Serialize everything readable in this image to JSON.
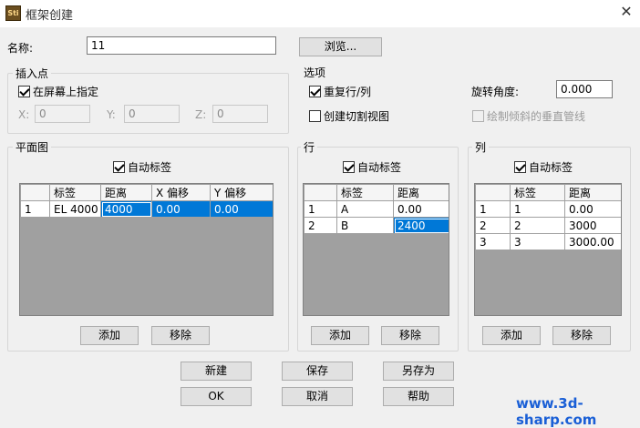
{
  "window": {
    "title": "框架创建",
    "icon_text": "Sti"
  },
  "name_row": {
    "label": "名称:",
    "value": "11",
    "browse_label": "浏览..."
  },
  "insert_point": {
    "title": "插入点",
    "on_screen_label": "在屏幕上指定",
    "on_screen_checked": true,
    "x_label": "X:",
    "x_value": "0",
    "y_label": "Y:",
    "y_value": "0",
    "z_label": "Z:",
    "z_value": "0"
  },
  "options": {
    "title": "选项",
    "repeat_label": "重复行/列",
    "repeat_checked": true,
    "cut_view_label": "创建切割视图",
    "cut_view_checked": false,
    "rotation_label": "旋转角度:",
    "rotation_value": "0.000",
    "draw_vertical_label": "绘制倾斜的垂直管线",
    "draw_vertical_checked": false
  },
  "plan": {
    "title": "平面图",
    "auto_label": "自动标签",
    "auto_checked": true,
    "headers": [
      "",
      "标签",
      "距离",
      "X 偏移",
      "Y 偏移"
    ],
    "rows": [
      [
        "1",
        "EL 4000",
        "4000",
        "0.00",
        "0.00"
      ]
    ],
    "add_label": "添加",
    "remove_label": "移除"
  },
  "rows_panel": {
    "title": "行",
    "auto_label": "自动标签",
    "auto_checked": true,
    "headers": [
      "",
      "标签",
      "距离"
    ],
    "rows": [
      [
        "1",
        "A",
        "0.00"
      ],
      [
        "2",
        "B",
        "2400"
      ]
    ],
    "add_label": "添加",
    "remove_label": "移除"
  },
  "cols_panel": {
    "title": "列",
    "auto_label": "自动标签",
    "auto_checked": true,
    "headers": [
      "",
      "标签",
      "距离"
    ],
    "rows": [
      [
        "1",
        "1",
        "0.00"
      ],
      [
        "2",
        "2",
        "3000"
      ],
      [
        "3",
        "3",
        "3000.00"
      ]
    ],
    "add_label": "添加",
    "remove_label": "移除"
  },
  "bottom_buttons": {
    "new": "新建",
    "save": "保存",
    "save_as": "另存为",
    "ok": "OK",
    "cancel": "取消",
    "help": "帮助"
  },
  "watermark": "www.3d-sharp.com",
  "colors": {
    "selection": "#0078d7",
    "grid_bg": "#a0a0a0",
    "dialog_bg": "#f0f0f0",
    "watermark": "#1a5fd6"
  }
}
